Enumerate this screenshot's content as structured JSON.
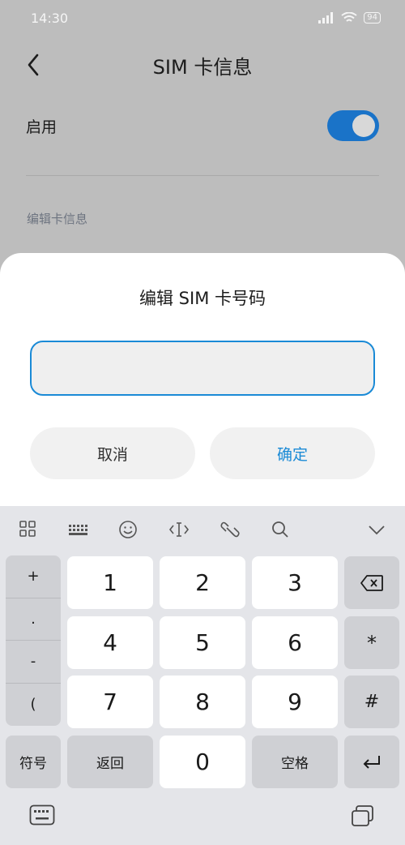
{
  "status": {
    "time": "14:30",
    "battery": "94"
  },
  "header": {
    "title": "SIM 卡信息"
  },
  "settings": {
    "enable_label": "启用",
    "section_label": "编辑卡信息"
  },
  "dialog": {
    "title": "编辑 SIM 卡号码",
    "input_value": "",
    "cancel_label": "取消",
    "confirm_label": "确定"
  },
  "keyboard": {
    "side_keys": [
      "+",
      ".",
      "-",
      "("
    ],
    "digits": [
      "1",
      "2",
      "3",
      "4",
      "5",
      "6",
      "7",
      "8",
      "9",
      "0"
    ],
    "star": "*",
    "hash": "#",
    "symbols_label": "符号",
    "back_label": "返回",
    "space_label": "空格"
  },
  "colors": {
    "accent": "#1a8ad6",
    "toggle_on": "#1a73c8"
  }
}
